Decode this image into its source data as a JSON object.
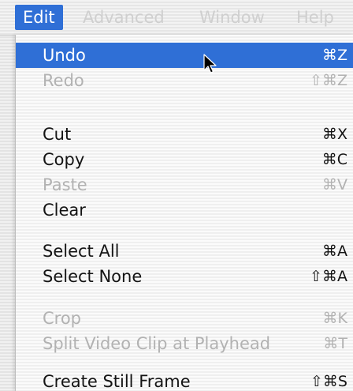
{
  "menubar": {
    "items": [
      {
        "label": "Edit"
      },
      {
        "label": "Advanced"
      },
      {
        "label": "Window"
      },
      {
        "label": "Help"
      }
    ]
  },
  "menu": {
    "items": [
      {
        "label": "Undo",
        "shortcut": "⌘Z",
        "enabled": true,
        "highlighted": true
      },
      {
        "label": "Redo",
        "shortcut": "⇧⌘Z",
        "enabled": false
      },
      {
        "label": "Cut",
        "shortcut": "⌘X",
        "enabled": true
      },
      {
        "label": "Copy",
        "shortcut": "⌘C",
        "enabled": true
      },
      {
        "label": "Paste",
        "shortcut": "⌘V",
        "enabled": false
      },
      {
        "label": "Clear",
        "shortcut": "",
        "enabled": true
      },
      {
        "label": "Select All",
        "shortcut": "⌘A",
        "enabled": true
      },
      {
        "label": "Select None",
        "shortcut": "⇧⌘A",
        "enabled": true
      },
      {
        "label": "Crop",
        "shortcut": "⌘K",
        "enabled": false
      },
      {
        "label": "Split Video Clip at Playhead",
        "shortcut": "⌘T",
        "enabled": false
      },
      {
        "label": "Create Still Frame",
        "shortcut": "⇧⌘S",
        "enabled": true
      }
    ]
  },
  "colors": {
    "highlight": "#2f6fd6",
    "disabled_text": "#b2b2b2",
    "text": "#141414"
  }
}
